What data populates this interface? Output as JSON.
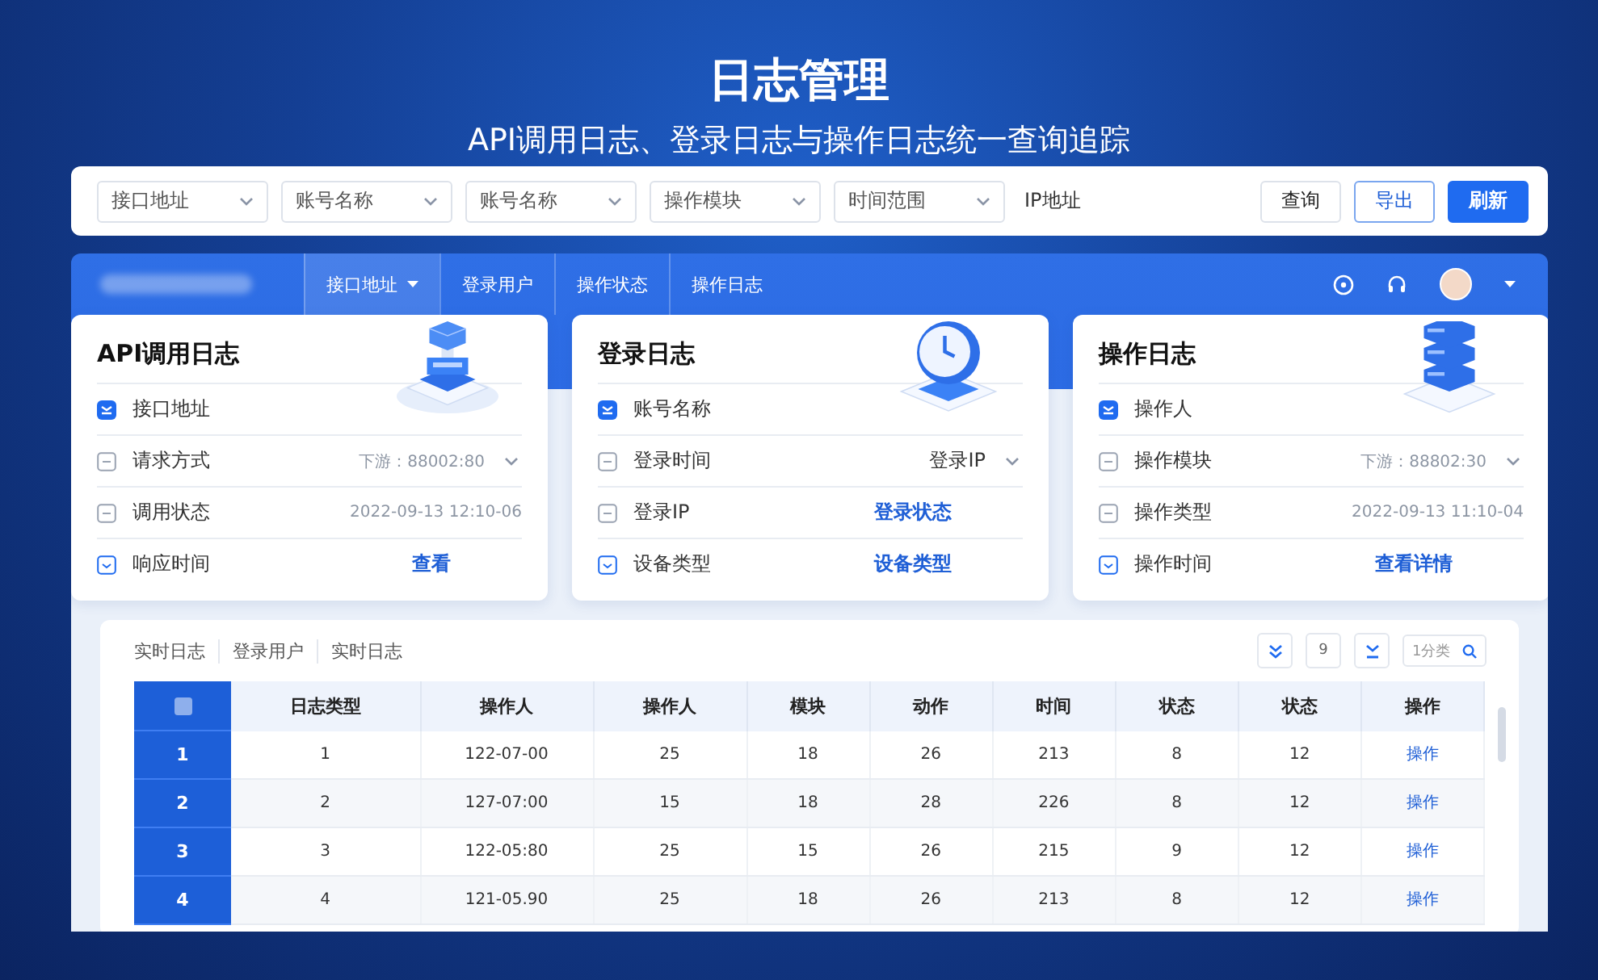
{
  "header": {
    "title": "日志管理",
    "subtitle": "API调用日志、登录日志与操作日志统一查询追踪"
  },
  "filter_bar": {
    "selects": [
      {
        "placeholder": "接口地址"
      },
      {
        "placeholder": "账号名称"
      },
      {
        "placeholder": "账号名称"
      },
      {
        "placeholder": "操作模块"
      },
      {
        "placeholder": "时间范围"
      }
    ],
    "ip_label": "IP地址",
    "buttons": [
      {
        "label": "查询",
        "kind": "default"
      },
      {
        "label": "导出",
        "kind": "outline"
      },
      {
        "label": "刷新",
        "kind": "primary"
      }
    ]
  },
  "nav": {
    "items": [
      {
        "label": "接口地址",
        "selected": true,
        "dropdown": true
      },
      {
        "label": "登录用户",
        "selected": false,
        "dropdown": false
      },
      {
        "label": "操作状态",
        "selected": false,
        "dropdown": false
      },
      {
        "label": "操作日志",
        "selected": false,
        "dropdown": false
      }
    ]
  },
  "cards": [
    {
      "title": "API调用日志",
      "rows": [
        {
          "label": "接口地址",
          "kind": "plain"
        },
        {
          "label": "请求方式",
          "kind": "select",
          "value": "下游：88002:80"
        },
        {
          "label": "调用状态",
          "kind": "text",
          "value": "2022-09-13 12:10-06"
        },
        {
          "label": "响应时间",
          "kind": "link",
          "value": "查看"
        }
      ]
    },
    {
      "title": "登录日志",
      "rows": [
        {
          "label": "账号名称",
          "kind": "plain"
        },
        {
          "label": "登录时间",
          "kind": "select",
          "value": "登录IP"
        },
        {
          "label": "登录IP",
          "kind": "link",
          "value": "登录状态"
        },
        {
          "label": "设备类型",
          "kind": "link",
          "value": "设备类型"
        }
      ]
    },
    {
      "title": "操作日志",
      "rows": [
        {
          "label": "操作人",
          "kind": "plain"
        },
        {
          "label": "操作模块",
          "kind": "select",
          "value": "下游：88802:30"
        },
        {
          "label": "操作类型",
          "kind": "text",
          "value": "2022-09-13 11:10-04"
        },
        {
          "label": "操作时间",
          "kind": "link",
          "value": "查看详情"
        }
      ]
    }
  ],
  "table_panel": {
    "tabs": [
      "实时日志",
      "登录用户",
      "实时日志"
    ],
    "tool_count": "9",
    "search": {
      "placeholder": "1分类"
    },
    "select_all": {
      "checked": false
    },
    "columns": [
      "日志类型",
      "操作人",
      "操作人",
      "模块",
      "动作",
      "时间",
      "状态",
      "状态",
      "操作"
    ],
    "rows": [
      {
        "index": "1",
        "cells": [
          "1",
          "122-07-00",
          "25",
          "18",
          "26",
          "213",
          "8",
          "12"
        ],
        "action": "操作"
      },
      {
        "index": "2",
        "cells": [
          "2",
          "127-07:00",
          "15",
          "18",
          "28",
          "226",
          "8",
          "12"
        ],
        "action": "操作"
      },
      {
        "index": "3",
        "cells": [
          "3",
          "122-05:80",
          "25",
          "15",
          "26",
          "215",
          "9",
          "12"
        ],
        "action": "操作"
      },
      {
        "index": "4",
        "cells": [
          "4",
          "121-05.90",
          "25",
          "18",
          "26",
          "213",
          "8",
          "12"
        ],
        "action": "操作"
      }
    ]
  }
}
